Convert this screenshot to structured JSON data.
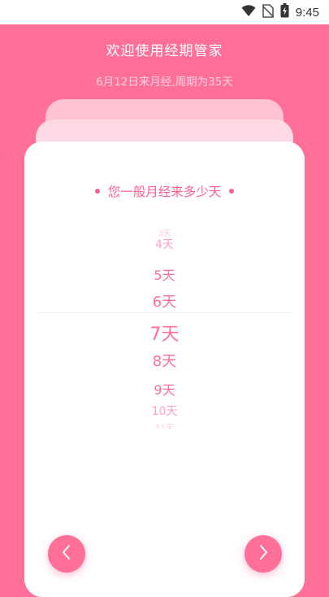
{
  "status_bar": {
    "time": "9:45",
    "icons": [
      "wifi-icon",
      "no-sim-icon",
      "battery-charging-icon"
    ]
  },
  "header": {
    "title": "欢迎使用经期管家",
    "subtitle": "6月12日来月经,周期为35天"
  },
  "card": {
    "question": "您一般月经来多少天",
    "picker": {
      "selected": "7天",
      "items": [
        "3天",
        "4天",
        "5天",
        "6天",
        "7天",
        "8天",
        "9天",
        "10天",
        "11天"
      ]
    }
  },
  "navigation": {
    "prev_icon": "chevron-left-icon",
    "next_icon": "chevron-right-icon"
  },
  "colors": {
    "primary_pink": "#ff6f97",
    "text_pink": "#ff5f8e",
    "card_white": "#ffffff"
  }
}
